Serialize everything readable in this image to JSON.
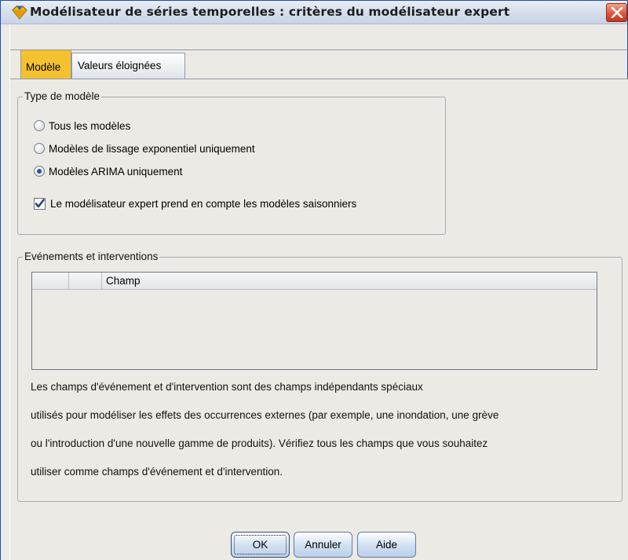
{
  "window": {
    "title": "Modélisateur de séries temporelles : critères du modélisateur expert"
  },
  "tabs": [
    {
      "label": "Modèle",
      "active": true
    },
    {
      "label": "Valeurs éloignées",
      "active": false
    }
  ],
  "model_type": {
    "legend": "Type de modèle",
    "options": [
      {
        "label": "Tous les modèles",
        "selected": false
      },
      {
        "label": "Modèles de lissage exponentiel uniquement",
        "selected": false
      },
      {
        "label": "Modèles ARIMA uniquement",
        "selected": true
      }
    ],
    "seasonal_checkbox": {
      "label": "Le modélisateur expert prend en compte les modèles saisonniers",
      "checked": true
    }
  },
  "events": {
    "legend": "Evénements et interventions",
    "table_header": "Champ",
    "description": [
      "Les champs d'événement et d'intervention sont des champs indépendants spéciaux",
      "utilisés pour modéliser les effets des occurrences externes (par exemple, une inondation, une grève",
      "ou l'introduction d'une nouvelle gamme de produits). Vérifiez tous les champs que vous souhaitez",
      "utiliser comme champs d'événement et d'intervention."
    ]
  },
  "buttons": {
    "ok": "OK",
    "cancel": "Annuler",
    "help": "Aide"
  },
  "colors": {
    "active_tab": "#f6c12f",
    "close_button": "#d4452a",
    "radio_selected": "#2c4fa3"
  }
}
